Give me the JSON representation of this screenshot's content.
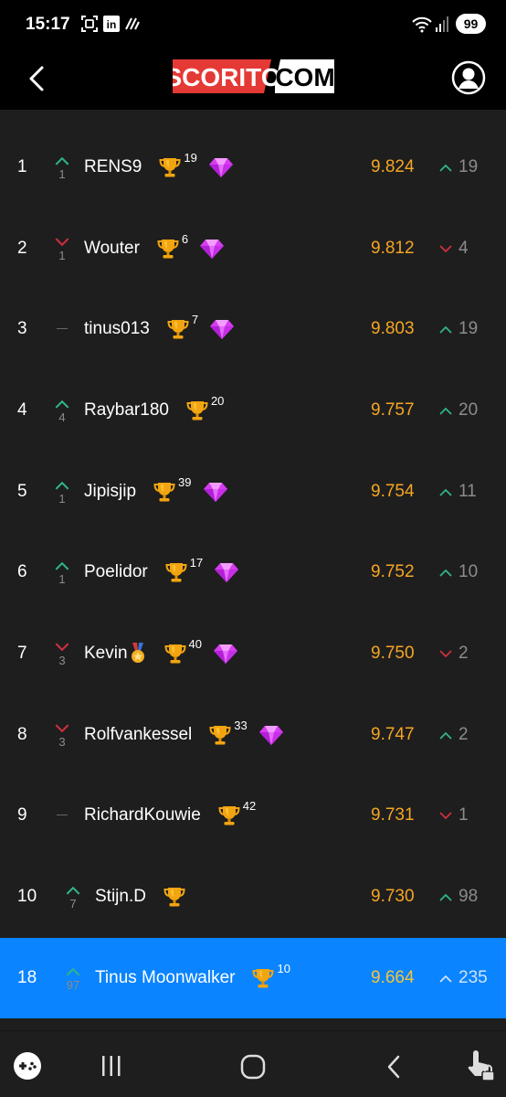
{
  "status_bar": {
    "time": "15:17",
    "battery": "99",
    "icons": [
      "screenshot-icon",
      "linkedin-icon",
      "data-saver-icon",
      "wifi-icon",
      "signal-icon"
    ]
  },
  "header": {
    "logo_left": "SCORITO",
    "logo_right": "COM",
    "colors": {
      "logo_red": "#e53935",
      "background": "#000000"
    }
  },
  "leaderboard": {
    "rows": [
      {
        "rank": "1",
        "move_dir": "up",
        "move": "1",
        "name": "RENS9",
        "medal": false,
        "trophies": "19",
        "gem": true,
        "points": "9.824",
        "delta_dir": "up",
        "delta": "19"
      },
      {
        "rank": "2",
        "move_dir": "down",
        "move": "1",
        "name": "Wouter",
        "medal": false,
        "trophies": "6",
        "gem": true,
        "points": "9.812",
        "delta_dir": "down",
        "delta": "4"
      },
      {
        "rank": "3",
        "move_dir": "none",
        "move": "",
        "name": "tinus013",
        "medal": false,
        "trophies": "7",
        "gem": true,
        "points": "9.803",
        "delta_dir": "up",
        "delta": "19"
      },
      {
        "rank": "4",
        "move_dir": "up",
        "move": "4",
        "name": "Raybar180",
        "medal": false,
        "trophies": "20",
        "gem": false,
        "points": "9.757",
        "delta_dir": "up",
        "delta": "20"
      },
      {
        "rank": "5",
        "move_dir": "up",
        "move": "1",
        "name": "Jipisjip",
        "medal": false,
        "trophies": "39",
        "gem": true,
        "points": "9.754",
        "delta_dir": "up",
        "delta": "11"
      },
      {
        "rank": "6",
        "move_dir": "up",
        "move": "1",
        "name": "Poelidor",
        "medal": false,
        "trophies": "17",
        "gem": true,
        "points": "9.752",
        "delta_dir": "up",
        "delta": "10"
      },
      {
        "rank": "7",
        "move_dir": "down",
        "move": "3",
        "name": "Kevin",
        "medal": true,
        "trophies": "40",
        "gem": true,
        "points": "9.750",
        "delta_dir": "down",
        "delta": "2"
      },
      {
        "rank": "8",
        "move_dir": "down",
        "move": "3",
        "name": "Rolfvankessel",
        "medal": false,
        "trophies": "33",
        "gem": true,
        "points": "9.747",
        "delta_dir": "up",
        "delta": "2"
      },
      {
        "rank": "9",
        "move_dir": "none",
        "move": "",
        "name": "RichardKouwie",
        "medal": false,
        "trophies": "42",
        "gem": false,
        "points": "9.731",
        "delta_dir": "down",
        "delta": "1"
      },
      {
        "rank": "10",
        "move_dir": "up",
        "move": "7",
        "name": "Stijn.D",
        "medal": false,
        "trophies": "",
        "gem": false,
        "points": "9.730",
        "delta_dir": "up",
        "delta": "98"
      },
      {
        "rank": "18",
        "move_dir": "up",
        "move": "97",
        "name": "Tinus Moonwalker",
        "medal": false,
        "trophies": "10",
        "gem": false,
        "points": "9.664",
        "delta_dir": "up",
        "delta": "235",
        "highlight": true
      }
    ],
    "colors": {
      "points": "#f5a623",
      "up": "#2fb58a",
      "down": "#d0303f",
      "highlight": "#0a84ff"
    }
  },
  "nav_bar": {
    "icons": [
      "game-launcher-icon",
      "recent-apps-icon",
      "home-icon",
      "back-nav-icon",
      "touch-lock-icon"
    ]
  }
}
